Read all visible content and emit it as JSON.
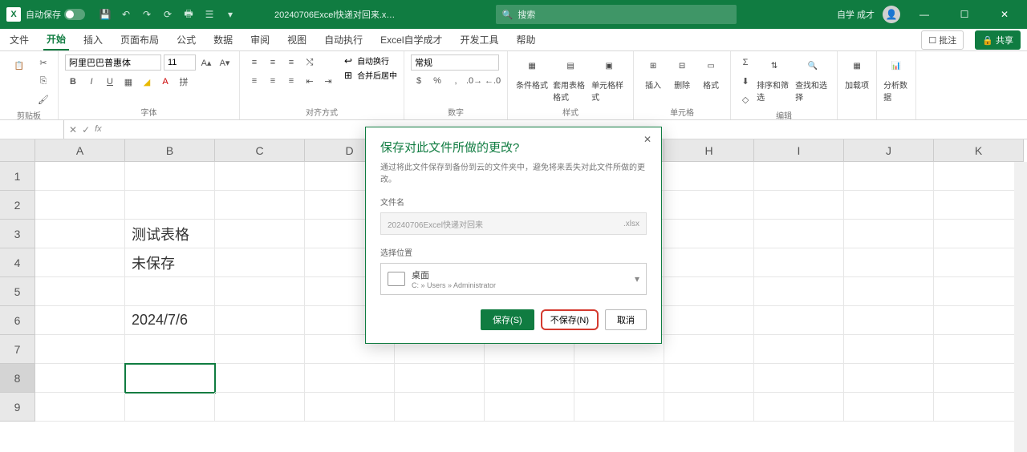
{
  "titlebar": {
    "autosave_label": "自动保存",
    "filename": "20240706Excel快递对回来.x…",
    "search_placeholder": "搜索",
    "user": "自学 成才"
  },
  "tabs": {
    "file": "文件",
    "home": "开始",
    "insert": "插入",
    "layout": "页面布局",
    "formulas": "公式",
    "data": "数据",
    "review": "审阅",
    "view": "视图",
    "automate": "自动执行",
    "selfstudy": "Excel自学成才",
    "dev": "开发工具",
    "help": "帮助",
    "comments": "批注",
    "share": "共享"
  },
  "ribbon": {
    "clipboard": "剪贴板",
    "font": "字体",
    "font_name": "阿里巴巴普惠体",
    "font_size": "11",
    "align": "对齐方式",
    "wrap": "自动换行",
    "merge": "合并后居中",
    "number": "数字",
    "number_format": "常规",
    "styles": "样式",
    "condfmt": "条件格式",
    "tablefmt": "套用表格格式",
    "cellstyles": "单元格样式",
    "cells": "单元格",
    "insert_btn": "插入",
    "delete_btn": "删除",
    "format_btn": "格式",
    "editing": "编辑",
    "sortfilter": "排序和筛选",
    "findselect": "查找和选择",
    "addins": "加载项",
    "analysis": "分析数据"
  },
  "formula_bar": {
    "namebox": ""
  },
  "grid": {
    "cols": [
      "A",
      "B",
      "C",
      "D",
      "E",
      "F",
      "G",
      "H",
      "I",
      "J",
      "K"
    ],
    "rows": [
      "1",
      "2",
      "3",
      "4",
      "5",
      "6",
      "7",
      "8",
      "9"
    ],
    "b3": "测试表格",
    "b4": "未保存",
    "b6": "2024/7/6"
  },
  "dialog": {
    "title": "保存对此文件所做的更改?",
    "desc": "通过将此文件保存到备份到云的文件夹中，避免将来丢失对此文件所做的更改。",
    "filename_label": "文件名",
    "filename_value": "20240706Excel快递对回来",
    "file_ext": ".xlsx",
    "location_label": "选择位置",
    "location_name": "桌面",
    "location_path": "C: » Users » Administrator",
    "save": "保存(S)",
    "dontsave": "不保存(N)",
    "cancel": "取消"
  }
}
